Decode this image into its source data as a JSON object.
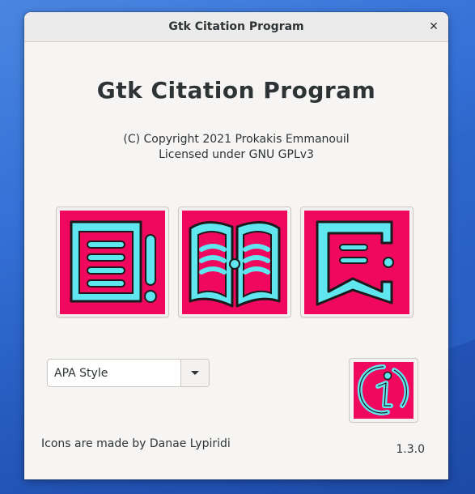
{
  "window": {
    "title": "Gtk Citation Program",
    "close_glyph": "✕"
  },
  "main": {
    "app_title": "Gtk Citation Program",
    "copyright_line1": "(C) Copyright 2021 Prokakis Emmanouil",
    "copyright_line2": "Licensed under GNU GPLv3",
    "icon_buttons": [
      {
        "icon": "document-icon"
      },
      {
        "icon": "book-icon"
      },
      {
        "icon": "bookmark-page-icon"
      }
    ],
    "style_select": {
      "value": "APA Style"
    },
    "info_button": {
      "icon": "info-icon"
    },
    "credit": "Icons are made by Danae Lypiridi",
    "version": "1.3.0"
  },
  "colors": {
    "icon_bg": "#f0085f",
    "icon_fg": "#5fe6ee",
    "icon_stroke": "#1a1a1a"
  }
}
